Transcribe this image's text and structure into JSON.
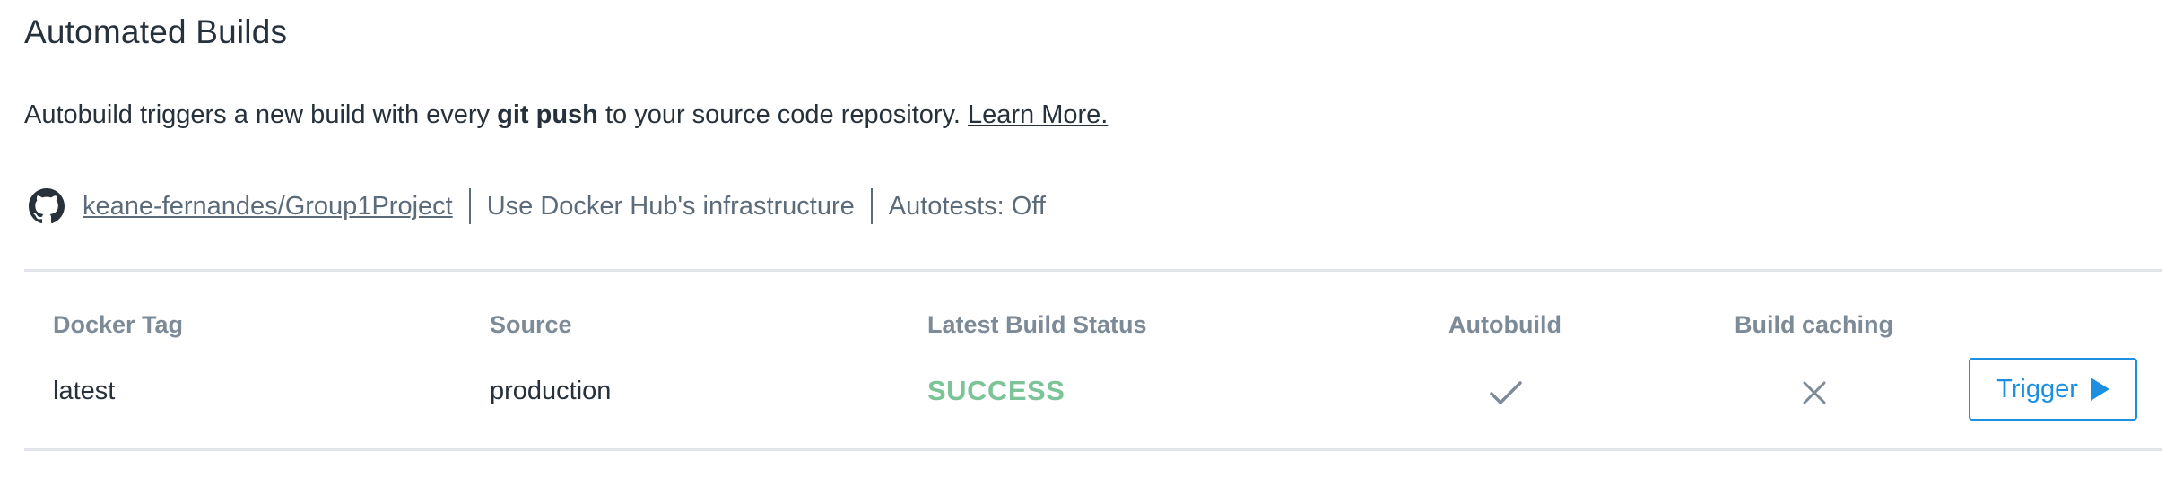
{
  "section": {
    "title": "Automated Builds",
    "description": {
      "prefix": "Autobuild triggers a new build with every ",
      "bold": "git push",
      "suffix": " to your source code repository. ",
      "link": "Learn More."
    }
  },
  "repo": {
    "icon": "github-icon",
    "name": "keane-fernandes/Group1Project",
    "infrastructure": "Use Docker Hub's infrastructure",
    "autotests": "Autotests: Off"
  },
  "table": {
    "headers": {
      "tag": "Docker Tag",
      "source": "Source",
      "status": "Latest Build Status",
      "autobuild": "Autobuild",
      "caching": "Build caching"
    },
    "rows": [
      {
        "tag": "latest",
        "source": "production",
        "status": "SUCCESS",
        "autobuild_icon": "check-icon",
        "caching_icon": "x-icon",
        "trigger_label": "Trigger"
      }
    ]
  },
  "colors": {
    "success": "#7cc497",
    "accent": "#1d8fe0",
    "muted": "#7d8b99",
    "text": "#27313b"
  }
}
